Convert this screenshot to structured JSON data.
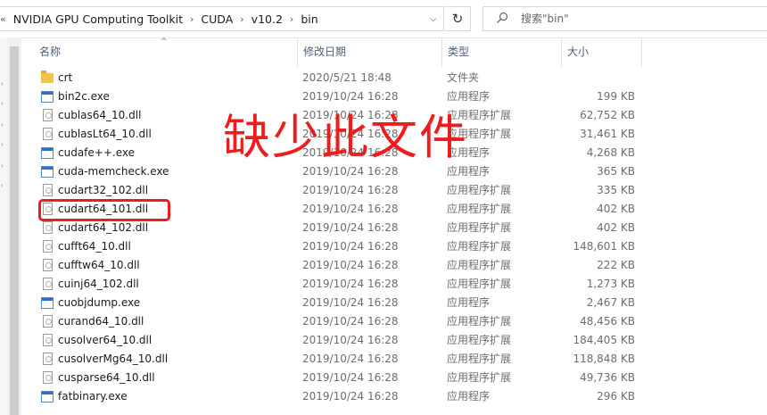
{
  "address_bar": {
    "breadcrumbs": [
      "NVIDIA GPU Computing Toolkit",
      "CUDA",
      "v10.2",
      "bin"
    ],
    "search_placeholder": "搜索\"bin\""
  },
  "columns": {
    "name": "名称",
    "date": "修改日期",
    "type": "类型",
    "size": "大小"
  },
  "files": [
    {
      "name": "crt",
      "date": "2020/5/21 18:48",
      "type": "文件夹",
      "size": "",
      "icon": "folder"
    },
    {
      "name": "bin2c.exe",
      "date": "2019/10/24 16:28",
      "type": "应用程序",
      "size": "199 KB",
      "icon": "exe"
    },
    {
      "name": "cublas64_10.dll",
      "date": "2019/10/24 16:28",
      "type": "应用程序扩展",
      "size": "62,752 KB",
      "icon": "dll"
    },
    {
      "name": "cublasLt64_10.dll",
      "date": "2019/10/24 16:28",
      "type": "应用程序扩展",
      "size": "31,461 KB",
      "icon": "dll"
    },
    {
      "name": "cudafe++.exe",
      "date": "2019/10/24 16:28",
      "type": "应用程序",
      "size": "4,268 KB",
      "icon": "exe"
    },
    {
      "name": "cuda-memcheck.exe",
      "date": "2019/10/24 16:28",
      "type": "应用程序",
      "size": "365 KB",
      "icon": "exe"
    },
    {
      "name": "cudart32_102.dll",
      "date": "2019/10/24 16:28",
      "type": "应用程序扩展",
      "size": "335 KB",
      "icon": "dll"
    },
    {
      "name": "cudart64_101.dll",
      "date": "2019/10/24 16:28",
      "type": "应用程序扩展",
      "size": "402 KB",
      "icon": "dll"
    },
    {
      "name": "cudart64_102.dll",
      "date": "2019/10/24 16:28",
      "type": "应用程序扩展",
      "size": "402 KB",
      "icon": "dll"
    },
    {
      "name": "cufft64_10.dll",
      "date": "2019/10/24 16:28",
      "type": "应用程序扩展",
      "size": "148,601 KB",
      "icon": "dll"
    },
    {
      "name": "cufftw64_10.dll",
      "date": "2019/10/24 16:28",
      "type": "应用程序扩展",
      "size": "222 KB",
      "icon": "dll"
    },
    {
      "name": "cuinj64_102.dll",
      "date": "2019/10/24 16:28",
      "type": "应用程序扩展",
      "size": "1,273 KB",
      "icon": "dll"
    },
    {
      "name": "cuobjdump.exe",
      "date": "2019/10/24 16:28",
      "type": "应用程序",
      "size": "2,467 KB",
      "icon": "exe"
    },
    {
      "name": "curand64_10.dll",
      "date": "2019/10/24 16:28",
      "type": "应用程序扩展",
      "size": "48,456 KB",
      "icon": "dll"
    },
    {
      "name": "cusolver64_10.dll",
      "date": "2019/10/24 16:28",
      "type": "应用程序扩展",
      "size": "184,405 KB",
      "icon": "dll"
    },
    {
      "name": "cusolverMg64_10.dll",
      "date": "2019/10/24 16:28",
      "type": "应用程序扩展",
      "size": "118,848 KB",
      "icon": "dll"
    },
    {
      "name": "cusparse64_10.dll",
      "date": "2019/10/24 16:28",
      "type": "应用程序扩展",
      "size": "49,736 KB",
      "icon": "dll"
    },
    {
      "name": "fatbinary.exe",
      "date": "2019/10/24 16:28",
      "type": "应用程序",
      "size": "296 KB",
      "icon": "exe"
    }
  ],
  "annotation": {
    "text": "缺少此文件",
    "color": "#ee1c1c"
  }
}
